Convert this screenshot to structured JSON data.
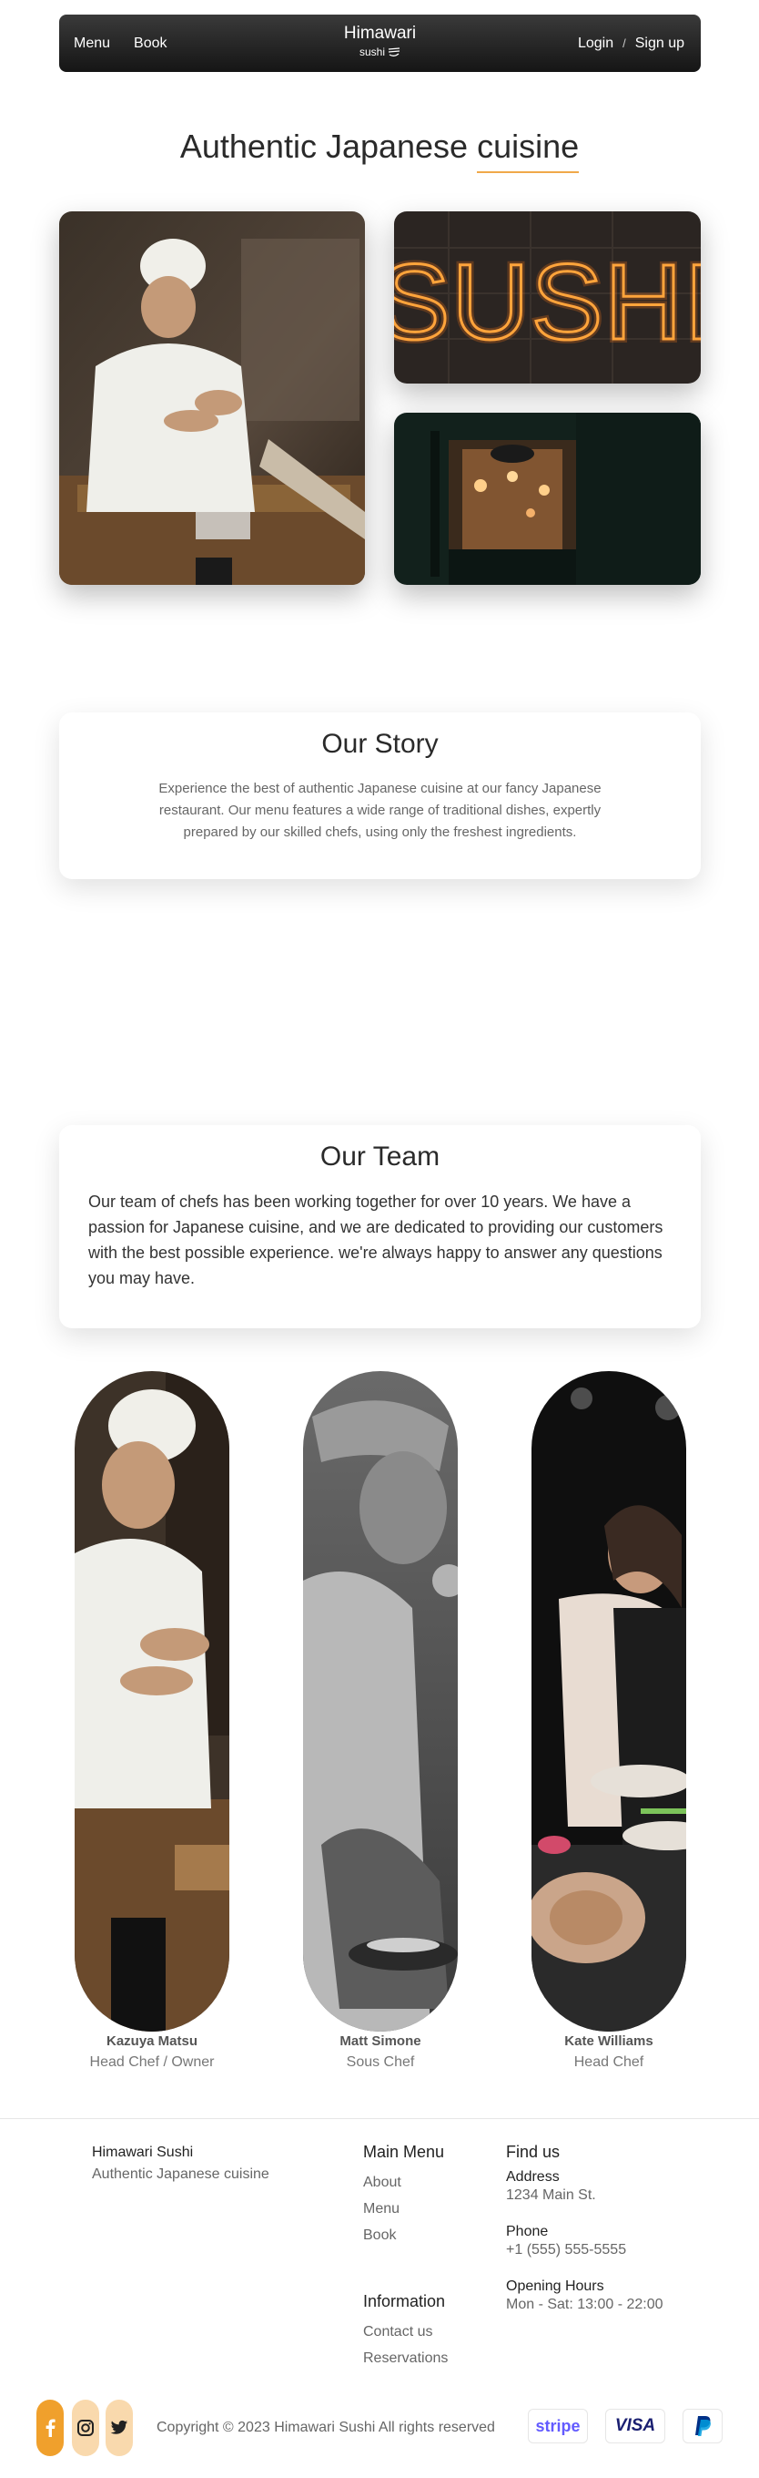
{
  "nav": {
    "menu": "Menu",
    "book": "Book",
    "brand_title": "Himawari",
    "brand_sub": "sushi",
    "login": "Login",
    "divider": "/",
    "signup": "Sign up"
  },
  "hero": {
    "title_a": "Authentic Japanese ",
    "title_b": "cuisine",
    "neon_text": "SUSHI"
  },
  "story": {
    "title": "Our Story",
    "text": "Experience the best of authentic Japanese cuisine at our fancy Japanese restaurant. Our menu features a wide range of traditional dishes, expertly prepared by our skilled chefs, using only the freshest ingredients."
  },
  "team": {
    "title": "Our Team",
    "text": "Our team of chefs has been working together for over 10 years. We have a passion for Japanese cuisine, and we are dedicated to providing our customers with the best possible experience. we're always happy to answer any questions you may have.",
    "members": [
      {
        "name": "Kazuya Matsu",
        "role": "Head Chef / Owner"
      },
      {
        "name": "Matt Simone",
        "role": "Sous Chef"
      },
      {
        "name": "Kate Williams",
        "role": "Head Chef"
      }
    ]
  },
  "footer": {
    "brand": "Himawari Sushi",
    "tagline": "Authentic Japanese cuisine",
    "main_menu": {
      "title": "Main Menu",
      "links": [
        "About",
        "Menu",
        "Book"
      ]
    },
    "information": {
      "title": "Information",
      "links": [
        "Contact us",
        "Reservations"
      ]
    },
    "find_us": {
      "title": "Find us",
      "address_label": "Address",
      "address": "1234 Main St.",
      "phone_label": "Phone",
      "phone": "+1 (555) 555-5555",
      "hours_label": "Opening Hours",
      "hours": "Mon - Sat: 13:00 - 22:00"
    },
    "copyright": "Copyright © 2023 Himawari Sushi All rights reserved",
    "payments": {
      "stripe": "stripe",
      "visa": "VISA"
    }
  },
  "icons": {
    "facebook": "facebook-icon",
    "instagram": "instagram-icon",
    "twitter": "twitter-icon",
    "paypal": "paypal-icon",
    "sushi": "sushi-icon"
  },
  "colors": {
    "accent": "#f0a94a",
    "accent_light": "#f9d9ad",
    "nav_dark": "#1f1f1f",
    "stripe": "#635bff",
    "visa": "#1a1f71",
    "paypal": "#003087"
  }
}
